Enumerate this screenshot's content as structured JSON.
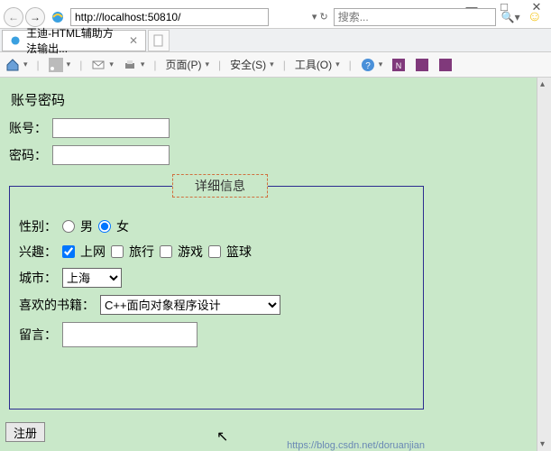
{
  "window": {
    "min": "—",
    "max": "□",
    "close": "✕"
  },
  "addr": {
    "url": "http://localhost:50810/",
    "search_placeholder": "搜索...",
    "refresh_label": "↻"
  },
  "tab": {
    "title": "王迪-HTML辅助方法输出...",
    "close": "✕"
  },
  "toolbar": {
    "page": "页面(P)",
    "safety": "安全(S)",
    "tools": "工具(O)"
  },
  "page": {
    "heading": "账号密码",
    "account_label": "账号：",
    "password_label": "密码：",
    "fieldset_legend": "详细信息",
    "gender_label": "性别：",
    "gender_male": "男",
    "gender_female": "女",
    "interest_label": "兴趣：",
    "interest_net": "上网",
    "interest_travel": "旅行",
    "interest_game": "游戏",
    "interest_basketball": "篮球",
    "city_label": "城市：",
    "city_selected": "上海",
    "book_label": "喜欢的书籍：",
    "book_selected": "C++面向对象程序设计",
    "message_label": "留言：",
    "submit": "注册"
  },
  "status_url": "https://blog.csdn.net/doruanjian"
}
